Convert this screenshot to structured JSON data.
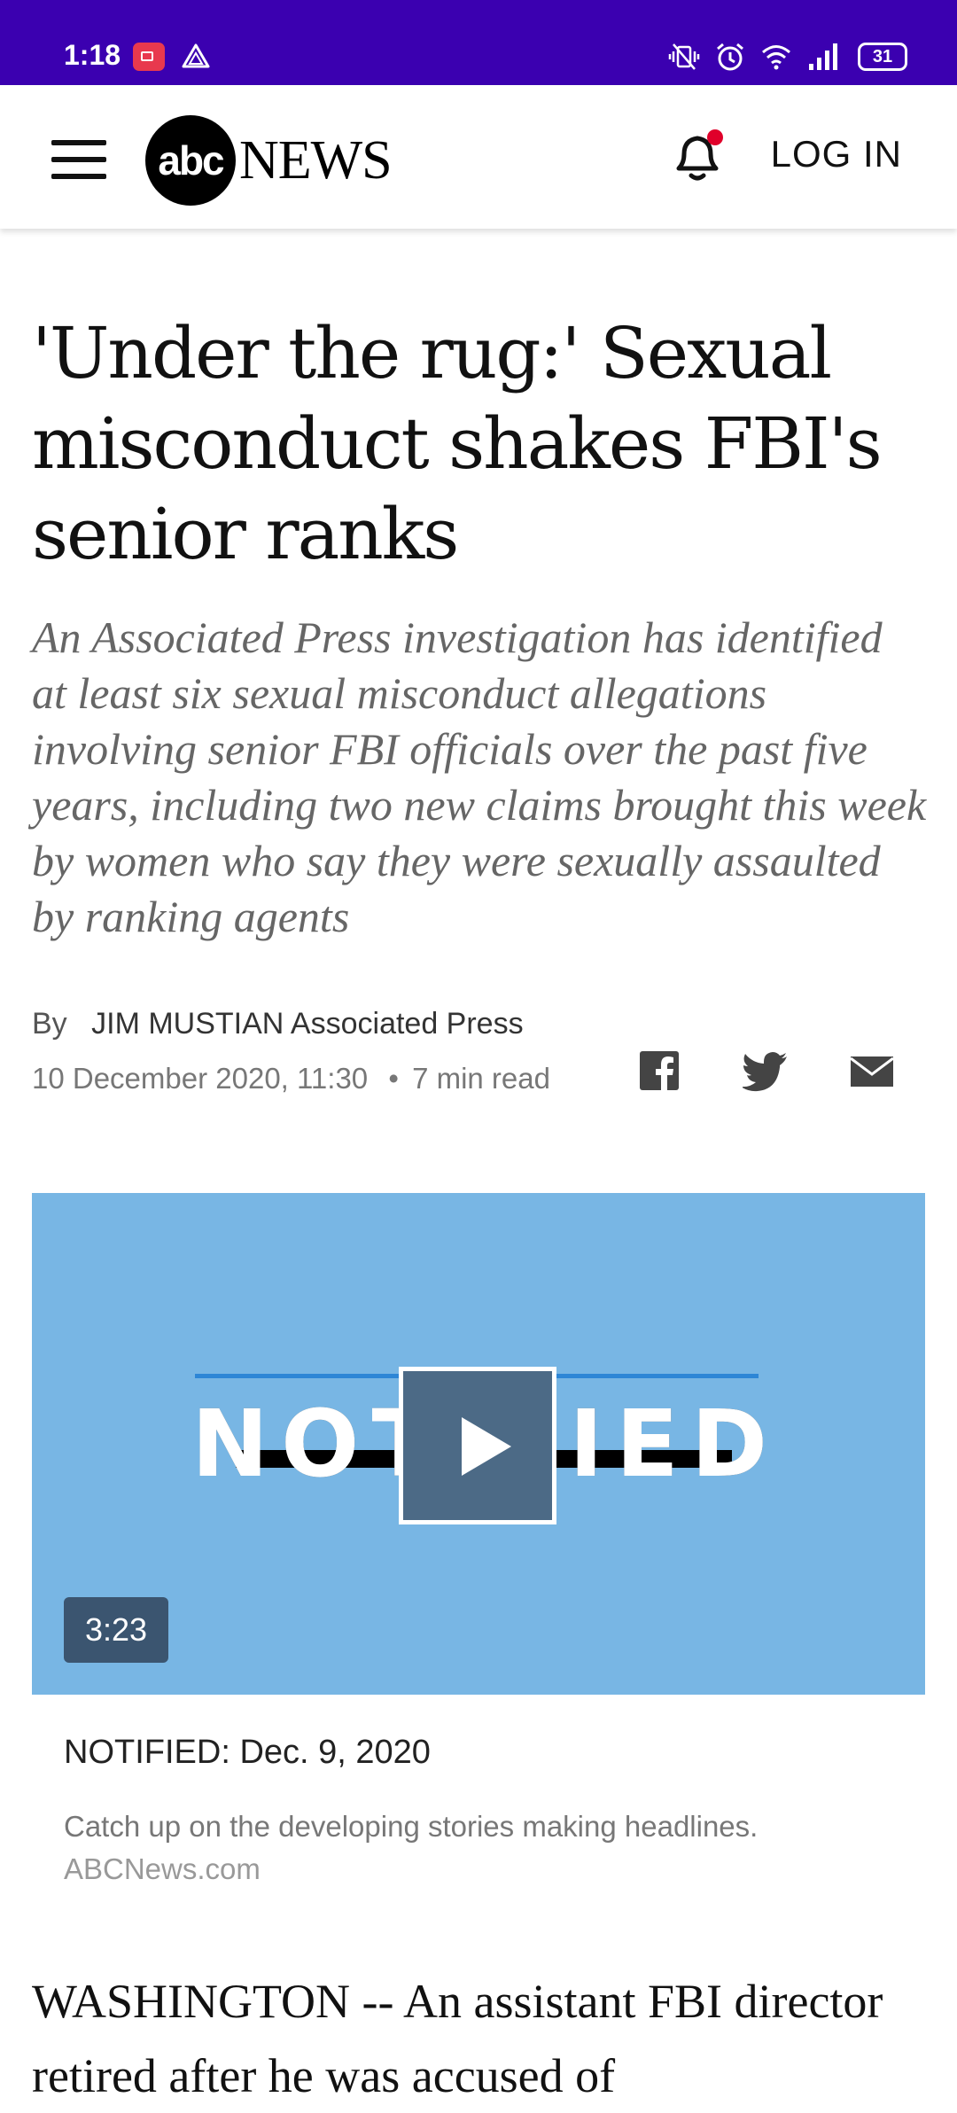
{
  "status_bar": {
    "time": "1:18",
    "battery": "31",
    "icons": [
      "screen-record-icon",
      "drive-icon",
      "vibrate-icon",
      "alarm-icon",
      "wifi-icon",
      "signal-icon",
      "battery-icon"
    ],
    "background": "#3b00b0"
  },
  "header": {
    "logo_abc": "abc",
    "logo_news": "NEWS",
    "notification_icon": "bell-icon",
    "login_label": "LOG IN"
  },
  "article": {
    "headline": "'Under the rug:' Sexual misconduct shakes FBI's senior ranks",
    "dek": "An Associated Press investigation has identified at least six sexual misconduct allegations involving senior FBI officials over the past five years, including two new claims brought this week by women who say they were sexually assaulted by ranking agents",
    "byline_prefix": "By",
    "author": "JIM MUSTIAN Associated Press",
    "date": "10 December 2020, 11:30",
    "read_time": "7 min read",
    "share_icons": [
      "facebook-icon",
      "twitter-icon",
      "email-icon"
    ],
    "body_start": "WASHINGTON -- An assistant FBI director retired after he was accused of"
  },
  "video": {
    "thumbnail_text": "NOTIFIED",
    "duration": "3:23",
    "title": "NOTIFIED: Dec. 9, 2020",
    "description": "Catch up on the developing stories making headlines.",
    "source": "ABCNews.com",
    "background": "#78b6e4"
  }
}
